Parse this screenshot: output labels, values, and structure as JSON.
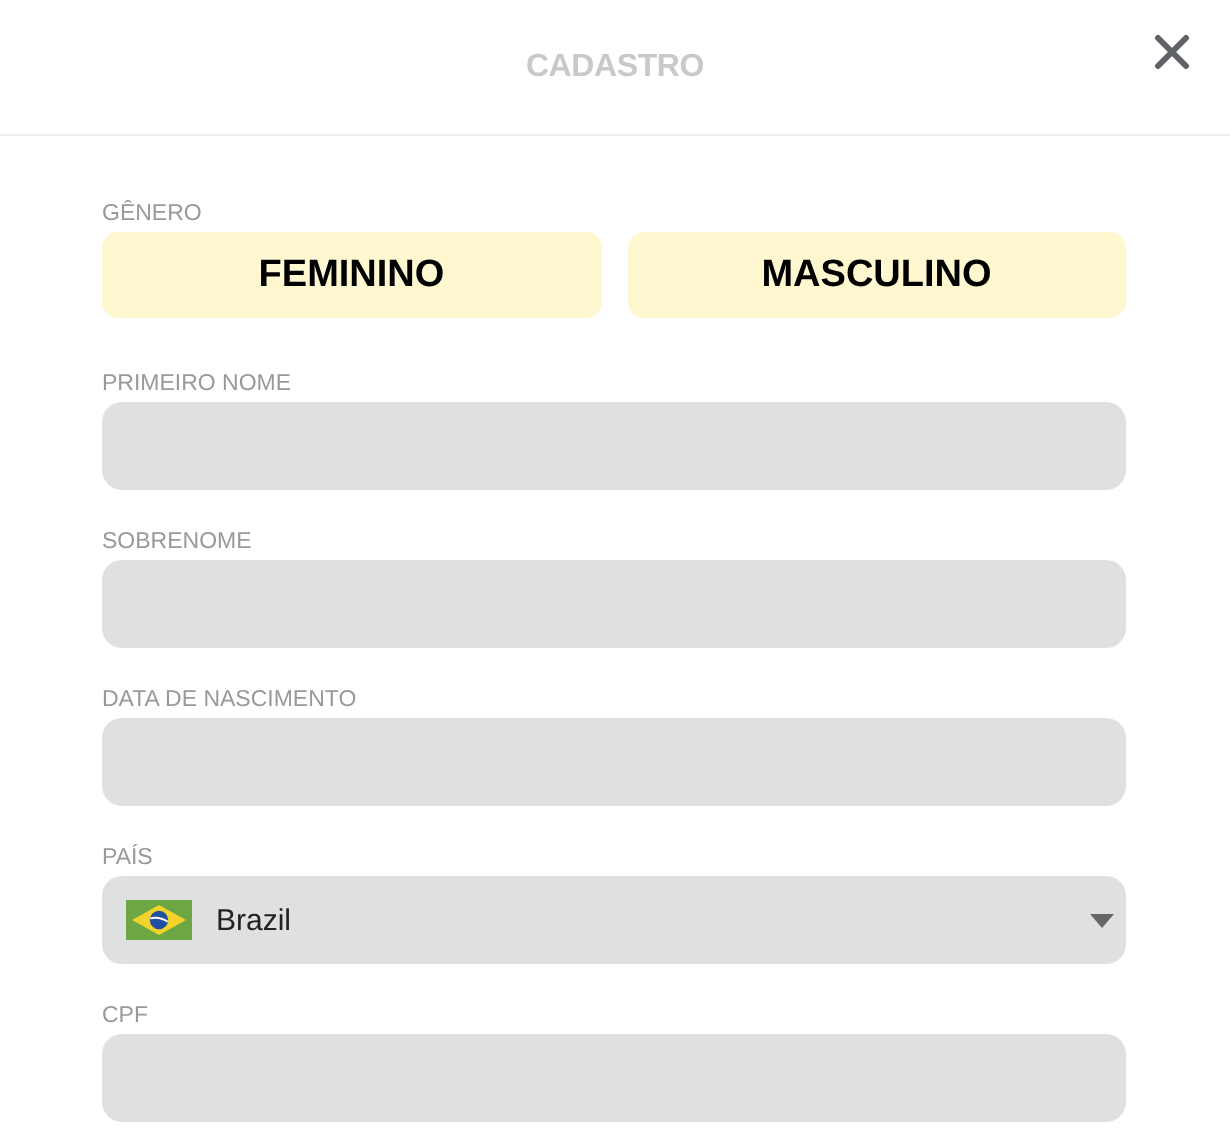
{
  "window": {
    "title": "CADASTRO"
  },
  "gender": {
    "label": "GÊNERO",
    "options": [
      {
        "label": "FEMININO",
        "selected": false
      },
      {
        "label": "MASCULINO",
        "selected": false
      }
    ]
  },
  "fields": [
    {
      "label": "PRIMEIRO NOME",
      "kind": "text"
    },
    {
      "label": "SOBRENOME",
      "kind": "text"
    },
    {
      "label": "DATA DE NASCIMENTO",
      "kind": "text"
    },
    {
      "label": "PAÍS",
      "kind": "select",
      "value": "Brazil"
    },
    {
      "label": "CPF",
      "kind": "text"
    }
  ]
}
